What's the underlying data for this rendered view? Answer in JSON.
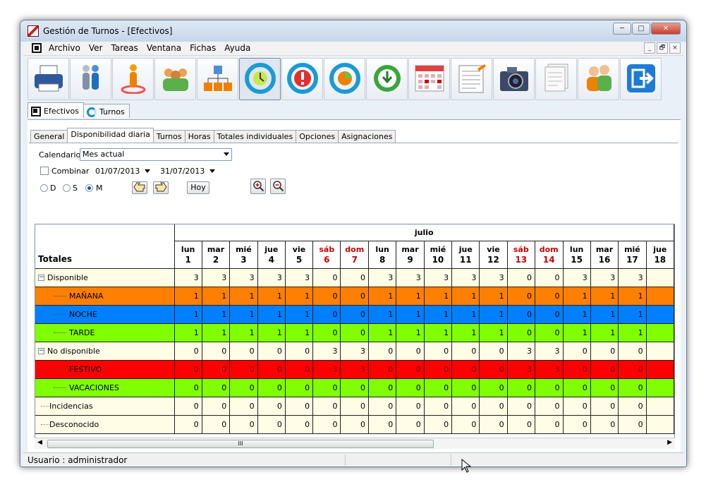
{
  "window": {
    "title": "Gestión de Turnos - [Efectivos]",
    "controls": [
      "─",
      "□",
      "✕"
    ]
  },
  "menu": {
    "items": [
      "Archivo",
      "Ver",
      "Tareas",
      "Ventana",
      "Fichas",
      "Ayuda"
    ],
    "mdi_controls": [
      "_",
      "🗗",
      "×"
    ]
  },
  "toolbar": {
    "icons": [
      "printer-icon",
      "people-walking-icon",
      "person-target-icon",
      "group-icon",
      "org-chart-icon",
      "clock-refresh-icon",
      "alert-refresh-icon",
      "pie-refresh-icon",
      "clock-down-icon",
      "calendar-grid-icon",
      "notepad-icon",
      "camera-icon",
      "documents-icon",
      "users-icon",
      "exit-icon"
    ]
  },
  "outer_tabs": [
    "Efectivos",
    "Turnos"
  ],
  "inner_tabs": [
    "General",
    "Disponibilidad diaria",
    "Turnos",
    "Horas",
    "Totales individuales",
    "Opciones",
    "Asignaciones"
  ],
  "filters": {
    "calendar_label": "Calendario",
    "calendar_value": "Mes actual",
    "combine_label": "Combinar",
    "date_from": "01/07/2013",
    "date_to": "31/07/2013",
    "view_options": [
      "D",
      "S",
      "M"
    ],
    "view_selected": "M",
    "today_button": "Hoy"
  },
  "grid": {
    "corner_label": "Totales",
    "month": "julio",
    "days": [
      {
        "dow": "lun",
        "num": "1",
        "weekend": false
      },
      {
        "dow": "mar",
        "num": "2",
        "weekend": false
      },
      {
        "dow": "mié",
        "num": "3",
        "weekend": false
      },
      {
        "dow": "jue",
        "num": "4",
        "weekend": false
      },
      {
        "dow": "vie",
        "num": "5",
        "weekend": false
      },
      {
        "dow": "sáb",
        "num": "6",
        "weekend": true
      },
      {
        "dow": "dom",
        "num": "7",
        "weekend": true
      },
      {
        "dow": "lun",
        "num": "8",
        "weekend": false
      },
      {
        "dow": "mar",
        "num": "9",
        "weekend": false
      },
      {
        "dow": "mié",
        "num": "10",
        "weekend": false
      },
      {
        "dow": "jue",
        "num": "11",
        "weekend": false
      },
      {
        "dow": "vie",
        "num": "12",
        "weekend": false
      },
      {
        "dow": "sáb",
        "num": "13",
        "weekend": true
      },
      {
        "dow": "dom",
        "num": "14",
        "weekend": true
      },
      {
        "dow": "lun",
        "num": "15",
        "weekend": false
      },
      {
        "dow": "mar",
        "num": "16",
        "weekend": false
      },
      {
        "dow": "mié",
        "num": "17",
        "weekend": false
      },
      {
        "dow": "jue",
        "num": "18",
        "weekend": false
      }
    ],
    "rows": [
      {
        "label": "Disponible",
        "level": 0,
        "expander": "−",
        "bg": "#fffde6",
        "values": [
          3,
          3,
          3,
          3,
          3,
          0,
          0,
          3,
          3,
          3,
          3,
          3,
          0,
          0,
          3,
          3,
          3,
          ""
        ]
      },
      {
        "label": "MAÑANA",
        "level": 1,
        "bg": "#ff8000",
        "values": [
          1,
          1,
          1,
          1,
          1,
          0,
          0,
          1,
          1,
          1,
          1,
          1,
          0,
          0,
          1,
          1,
          1,
          ""
        ]
      },
      {
        "label": "NOCHE",
        "level": 1,
        "bg": "#0080ff",
        "values": [
          1,
          1,
          1,
          1,
          1,
          0,
          0,
          1,
          1,
          1,
          1,
          1,
          0,
          0,
          1,
          1,
          1,
          ""
        ]
      },
      {
        "label": "TARDE",
        "level": 1,
        "bg": "#80ff00",
        "values": [
          1,
          1,
          1,
          1,
          1,
          0,
          0,
          1,
          1,
          1,
          1,
          1,
          0,
          0,
          1,
          1,
          1,
          ""
        ]
      },
      {
        "label": "No disponible",
        "level": 0,
        "expander": "−",
        "bg": "#fffde6",
        "values": [
          0,
          0,
          0,
          0,
          0,
          3,
          3,
          0,
          0,
          0,
          0,
          0,
          3,
          3,
          0,
          0,
          0,
          ""
        ]
      },
      {
        "label": "FESTIVO",
        "level": 1,
        "bg": "#ff0000",
        "values": [
          0,
          0,
          0,
          0,
          0,
          3,
          3,
          0,
          0,
          0,
          0,
          0,
          3,
          3,
          0,
          0,
          0,
          ""
        ]
      },
      {
        "label": "VACACIONES",
        "level": 1,
        "bg": "#80ff00",
        "values": [
          0,
          0,
          0,
          0,
          0,
          0,
          0,
          0,
          0,
          0,
          0,
          0,
          0,
          0,
          0,
          0,
          0,
          ""
        ]
      },
      {
        "label": "Incidencias",
        "level": 0,
        "bg": "#fffde6",
        "values": [
          0,
          0,
          0,
          0,
          0,
          0,
          0,
          0,
          0,
          0,
          0,
          0,
          0,
          0,
          0,
          0,
          0,
          ""
        ]
      },
      {
        "label": "Desconocido",
        "level": 0,
        "bg": "#fffde6",
        "values": [
          0,
          0,
          0,
          0,
          0,
          0,
          0,
          0,
          0,
          0,
          0,
          0,
          0,
          0,
          0,
          0,
          0,
          ""
        ]
      }
    ]
  },
  "scrollbar": {
    "thumb_label": "III"
  },
  "status": {
    "user": "Usuario : administrador"
  },
  "colors": {
    "weekend": "#cc0000"
  }
}
